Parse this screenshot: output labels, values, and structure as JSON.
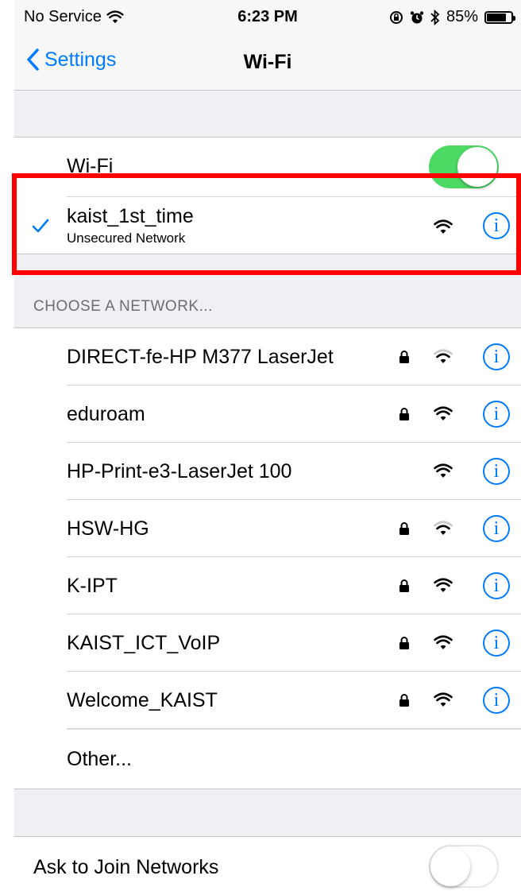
{
  "status_bar": {
    "carrier": "No Service",
    "time": "6:23 PM",
    "battery_text": "85%",
    "battery_level": 0.85
  },
  "nav": {
    "back_label": "Settings",
    "title": "Wi-Fi"
  },
  "wifi": {
    "label": "Wi-Fi",
    "enabled": true
  },
  "current_network": {
    "name": "kaist_1st_time",
    "subtitle": "Unsecured Network",
    "info_glyph": "i"
  },
  "choose_header": "CHOOSE A NETWORK...",
  "networks": [
    {
      "name": "DIRECT-fe-HP M377 LaserJet",
      "locked": true,
      "signal": "weak",
      "info_glyph": "i"
    },
    {
      "name": "eduroam",
      "locked": true,
      "signal": "strong",
      "info_glyph": "i"
    },
    {
      "name": "HP-Print-e3-LaserJet 100",
      "locked": false,
      "signal": "strong",
      "info_glyph": "i"
    },
    {
      "name": "HSW-HG",
      "locked": true,
      "signal": "weak",
      "info_glyph": "i"
    },
    {
      "name": "K-IPT",
      "locked": true,
      "signal": "strong",
      "info_glyph": "i"
    },
    {
      "name": "KAIST_ICT_VoIP",
      "locked": true,
      "signal": "strong",
      "info_glyph": "i"
    },
    {
      "name": "Welcome_KAIST",
      "locked": true,
      "signal": "strong",
      "info_glyph": "i"
    }
  ],
  "other_label": "Other...",
  "ask_to_join": {
    "label": "Ask to Join Networks",
    "enabled": false
  },
  "colors": {
    "accent": "#007aff",
    "toggle_on": "#4cd964",
    "highlight_box": "#ff0000",
    "group_bg": "#efeff4"
  },
  "icons": [
    "wifi-signal-icon",
    "lock-icon",
    "info-icon",
    "checkmark-icon",
    "chevron-left-icon",
    "alarm-icon",
    "bluetooth-icon",
    "rotation-lock-icon",
    "battery-icon"
  ]
}
